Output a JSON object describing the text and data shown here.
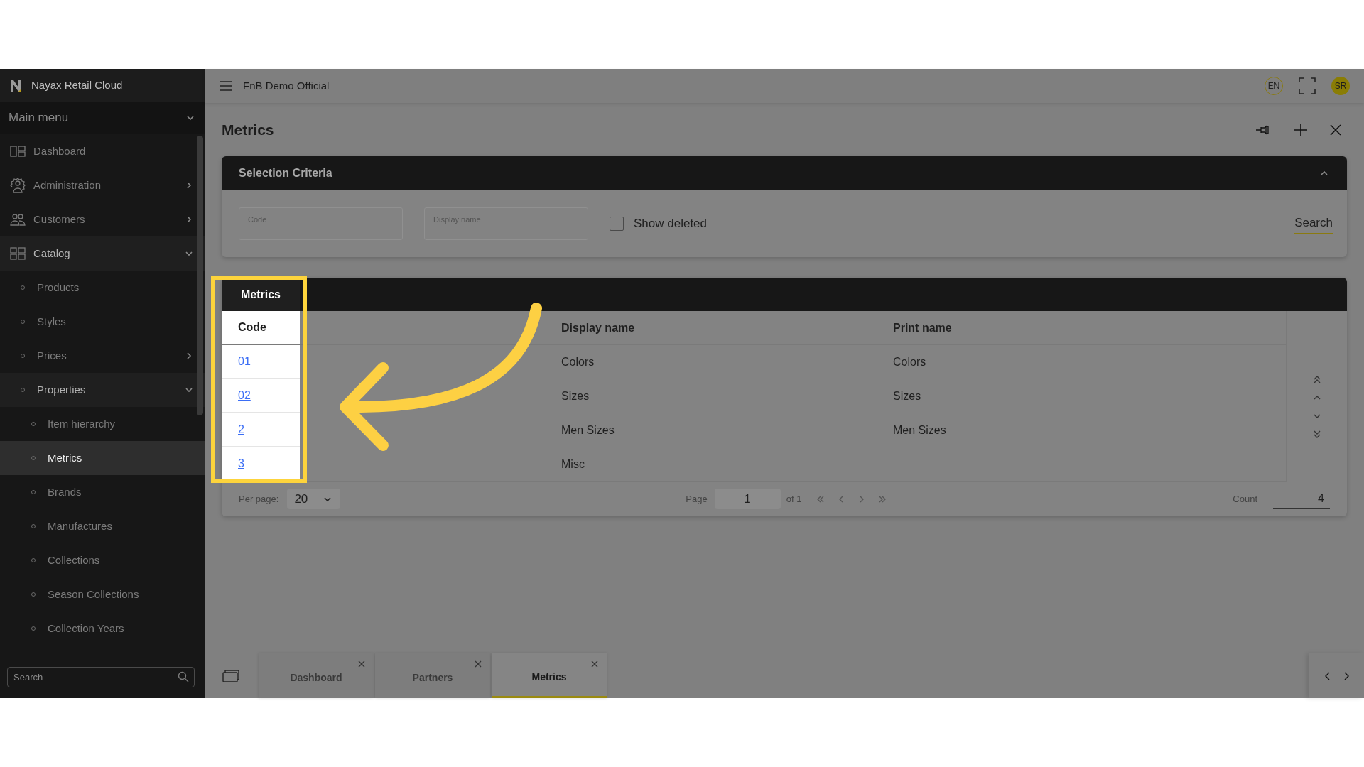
{
  "brand": {
    "title": "Nayax Retail Cloud"
  },
  "main_menu": {
    "label": "Main menu",
    "expanded": true
  },
  "sidebar": {
    "items": [
      {
        "label": "Dashboard",
        "selected": false
      },
      {
        "label": "Administration",
        "selected": false,
        "expanded": false
      },
      {
        "label": "Customers",
        "selected": false,
        "expanded": false
      },
      {
        "label": "Catalog",
        "selected": false,
        "expanded": true,
        "children": [
          {
            "label": "Products",
            "selected": false
          },
          {
            "label": "Styles",
            "selected": false
          },
          {
            "label": "Prices",
            "selected": false,
            "expanded": false
          },
          {
            "label": "Properties",
            "selected": false,
            "expanded": true,
            "children": [
              {
                "label": "Item hierarchy",
                "selected": false
              },
              {
                "label": "Metrics",
                "selected": true
              },
              {
                "label": "Brands",
                "selected": false
              },
              {
                "label": "Manufactures",
                "selected": false
              },
              {
                "label": "Collections",
                "selected": false
              },
              {
                "label": "Season Collections",
                "selected": false
              },
              {
                "label": "Collection Years",
                "selected": false
              }
            ]
          }
        ]
      }
    ],
    "search": {
      "placeholder": "Search"
    }
  },
  "header": {
    "company": "FnB Demo Official",
    "language": "EN",
    "avatar": "SR"
  },
  "page": {
    "title": "Metrics"
  },
  "selection_criteria": {
    "title": "Selection Criteria",
    "expanded": true,
    "fields": [
      {
        "label": "Code"
      },
      {
        "label": "Display name"
      }
    ],
    "show_deleted": {
      "label": "Show deleted",
      "checked": false
    },
    "search_button": "Search"
  },
  "grid": {
    "title": "Metrics",
    "columns": [
      "Code",
      "Display name",
      "Print name"
    ],
    "rows": [
      {
        "code": "01",
        "display_name": "Colors",
        "print_name": "Colors"
      },
      {
        "code": "02",
        "display_name": "Sizes",
        "print_name": "Sizes"
      },
      {
        "code": "2",
        "display_name": "Men Sizes",
        "print_name": "Men Sizes"
      },
      {
        "code": "3",
        "display_name": "Misc"
      }
    ],
    "pager": {
      "per_page_label": "Per page:",
      "per_page": "20",
      "page_label": "Page",
      "page": "1",
      "page_of": "of 1",
      "count_label": "Count",
      "count": "4"
    }
  },
  "tabs": [
    {
      "label": "Dashboard",
      "selected": false
    },
    {
      "label": "Partners",
      "selected": false
    },
    {
      "label": "Metrics",
      "selected": true
    }
  ]
}
